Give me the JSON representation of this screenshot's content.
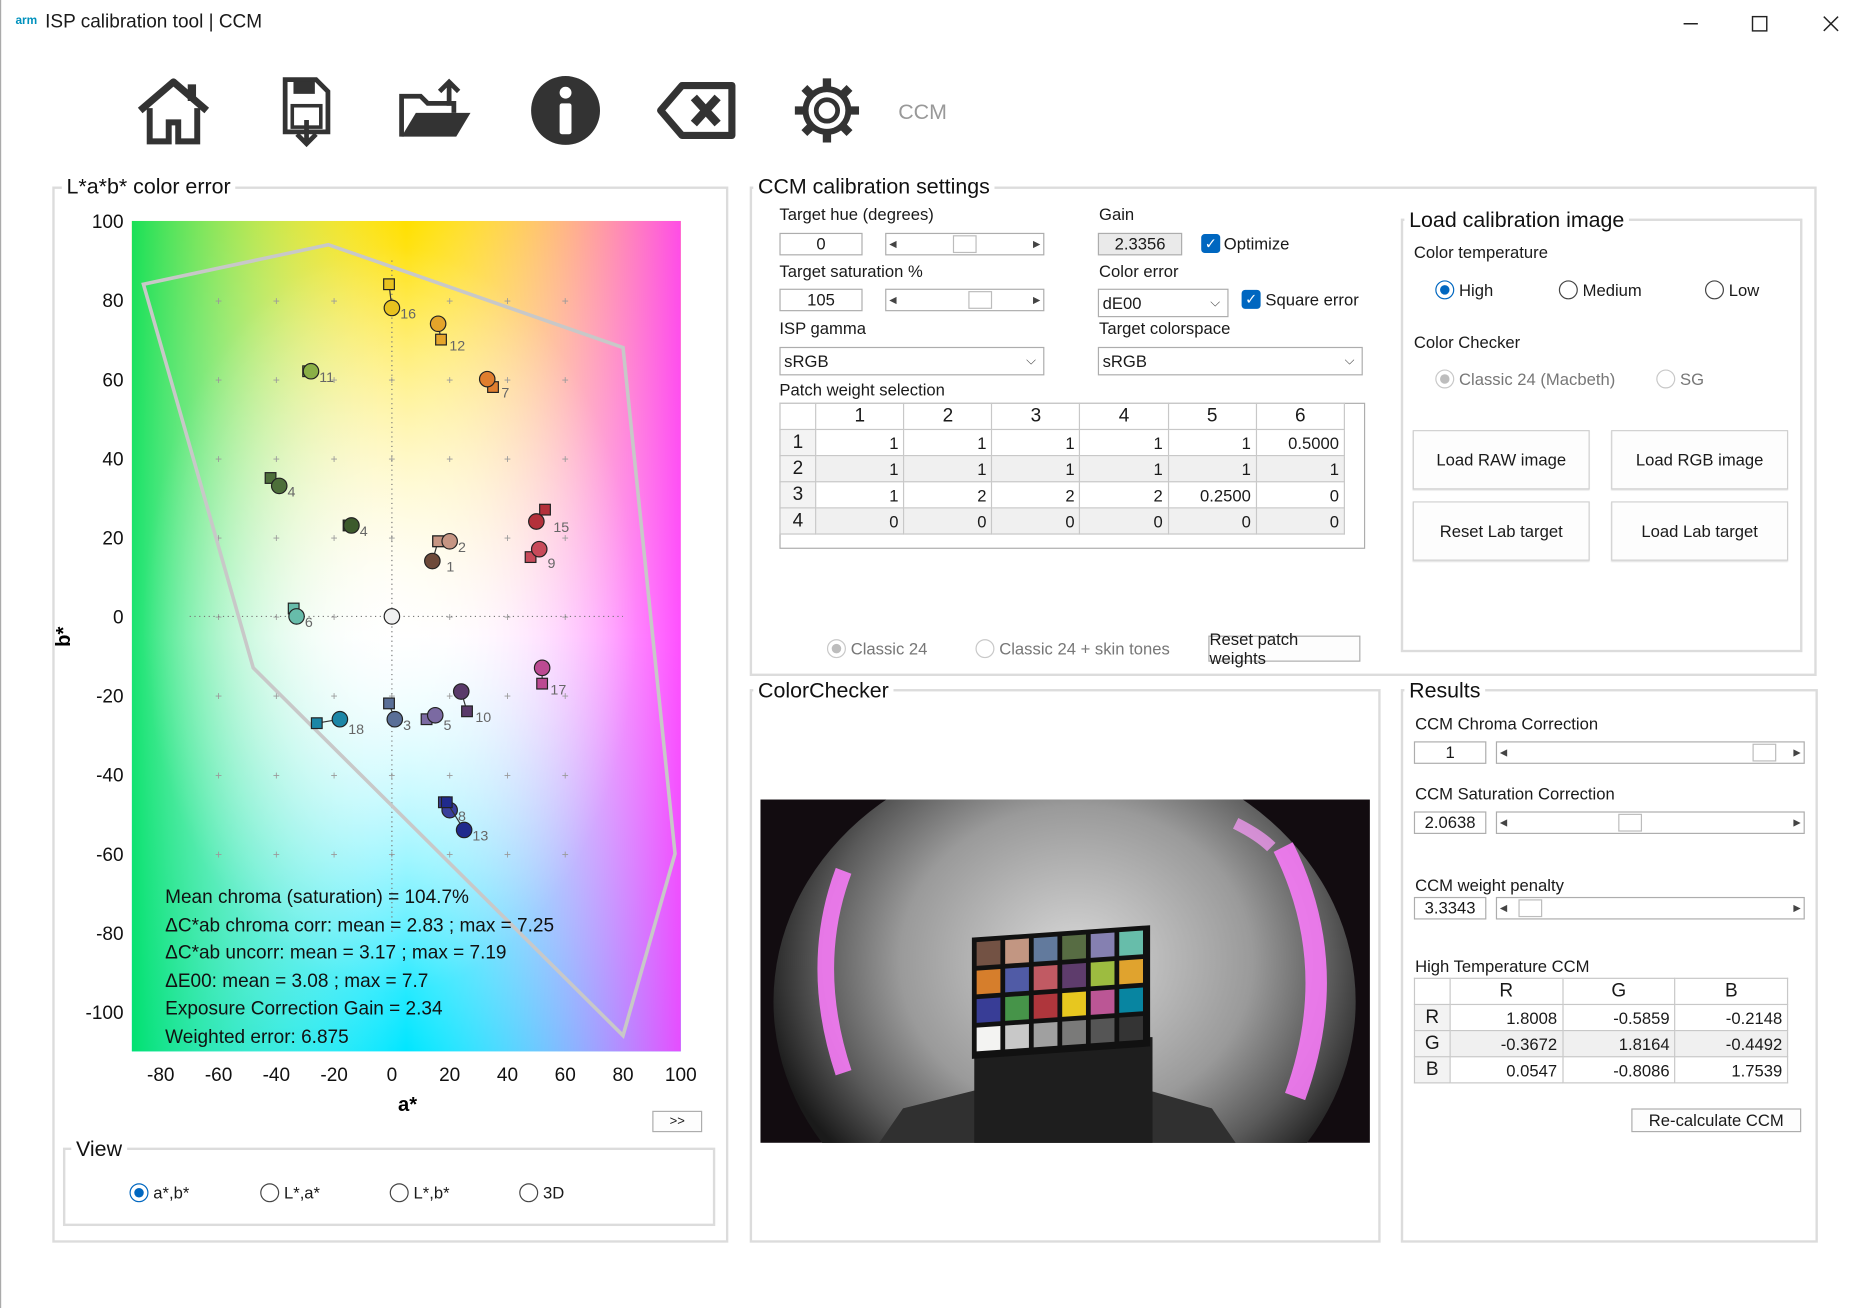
{
  "window": {
    "logo": "arm",
    "title": "ISP calibration tool | CCM"
  },
  "toolbar": {
    "items": [
      "home-icon",
      "save-icon",
      "open-folder-icon",
      "info-icon",
      "clear-icon",
      "settings-icon"
    ],
    "mode_label": "CCM"
  },
  "lab_panel": {
    "title": "L*a*b* color error",
    "xlabel": "a*",
    "ylabel": "b*",
    "stats": [
      "Mean chroma (saturation) = 104.7%",
      "ΔC*ab chroma corr: mean = 2.83 ; max = 7.25",
      "ΔC*ab uncorr: mean = 3.17 ; max = 7.19",
      "ΔE00: mean = 3.08 ; max = 7.7",
      "Exposure Correction Gain = 2.34",
      "Weighted error: 6.875"
    ],
    "expand_button": ">>"
  },
  "chart_data": {
    "type": "scatter",
    "title": "",
    "xlabel": "a*",
    "ylabel": "b*",
    "xlim": [
      -90,
      100
    ],
    "ylim": [
      -110,
      100
    ],
    "xticks": [
      -80,
      -60,
      -40,
      -20,
      0,
      20,
      40,
      60,
      80,
      100
    ],
    "yticks": [
      100,
      80,
      60,
      40,
      20,
      0,
      -20,
      -40,
      -60,
      -80,
      -100
    ],
    "gamut_outline": [
      [
        -86,
        84
      ],
      [
        -22,
        94
      ],
      [
        80,
        68
      ],
      [
        98,
        -60
      ],
      [
        80,
        -106
      ],
      [
        -48,
        -13
      ]
    ],
    "series": [
      {
        "markers": "circle (measured) + square (target)",
        "points": [
          {
            "id": "1",
            "a": 14,
            "b": 14,
            "ta": 16,
            "tb": 19,
            "color": "#6e4a3a"
          },
          {
            "id": "2",
            "a": 20,
            "b": 19,
            "ta": 16,
            "tb": 19,
            "color": "#c69583"
          },
          {
            "id": "3",
            "a": 1,
            "b": -26,
            "ta": -1,
            "tb": -22,
            "color": "#5a6f97"
          },
          {
            "id": "4",
            "a": -39,
            "b": 33,
            "ta": -42,
            "tb": 35,
            "color": "#4d6f3a"
          },
          {
            "id": "4",
            "a": -14,
            "b": 23,
            "ta": -15,
            "tb": 23,
            "color": "#3c5a2c"
          },
          {
            "id": "5",
            "a": 15,
            "b": -25,
            "ta": 12,
            "tb": -26,
            "color": "#7b6aa2"
          },
          {
            "id": "6",
            "a": -33,
            "b": 0,
            "ta": -34,
            "tb": 2,
            "color": "#67bcaa"
          },
          {
            "id": "7",
            "a": 33,
            "b": 60,
            "ta": 35,
            "tb": 58,
            "color": "#e07e2e"
          },
          {
            "id": "8",
            "a": 20,
            "b": -49,
            "ta": 18,
            "tb": -47,
            "color": "#3a3f9c"
          },
          {
            "id": "9",
            "a": 51,
            "b": 17,
            "ta": 48,
            "tb": 15,
            "color": "#c84a5a"
          },
          {
            "id": "10",
            "a": 24,
            "b": -19,
            "ta": 26,
            "tb": -24,
            "color": "#5a3a6a"
          },
          {
            "id": "11",
            "a": -28,
            "b": 62,
            "ta": -29,
            "tb": 62,
            "color": "#8ab046"
          },
          {
            "id": "12",
            "a": 16,
            "b": 74,
            "ta": 17,
            "tb": 70,
            "color": "#e4a42a"
          },
          {
            "id": "13",
            "a": 25,
            "b": -54,
            "ta": 19,
            "tb": -47,
            "color": "#202a8c"
          },
          {
            "id": "15",
            "a": 50,
            "b": 24,
            "ta": 53,
            "tb": 27,
            "color": "#b4303a"
          },
          {
            "id": "16",
            "a": 0,
            "b": 78,
            "ta": -1,
            "tb": 84,
            "color": "#e8c21e"
          },
          {
            "id": "17",
            "a": 52,
            "b": -13,
            "ta": 52,
            "tb": -17,
            "color": "#bc4a92"
          },
          {
            "id": "18",
            "a": -18,
            "b": -26,
            "ta": -26,
            "tb": -27,
            "color": "#1c86a6"
          },
          {
            "id": "",
            "a": 0,
            "b": 0,
            "ta": 0,
            "tb": 0,
            "color": "#f0f0f0"
          }
        ]
      }
    ],
    "grid": "dotted cross at origin",
    "legend": "none"
  },
  "view": {
    "title": "View",
    "options": [
      "a*,b*",
      "L*,a*",
      "L*,b*",
      "3D"
    ],
    "selected": "a*,b*"
  },
  "ccm_settings": {
    "title": "CCM calibration settings",
    "target_hue_label": "Target hue (degrees)",
    "target_hue": "0",
    "target_hue_level": 0.5,
    "target_sat_label": "Target saturation %",
    "target_sat": "105",
    "target_sat_level": 0.65,
    "gain_label": "Gain",
    "gain": "2.3356",
    "optimize_label": "Optimize",
    "optimize": true,
    "color_error_label": "Color error",
    "color_error": "dE00",
    "square_error_label": "Square error",
    "square_error": true,
    "isp_gamma_label": "ISP gamma",
    "isp_gamma": "sRGB",
    "target_colorspace_label": "Target colorspace",
    "target_colorspace": "sRGB",
    "patch_weight_label": "Patch weight selection",
    "weights": {
      "columns": [
        "1",
        "2",
        "3",
        "4",
        "5",
        "6"
      ],
      "rows": [
        {
          "h": "1",
          "cells": [
            "1",
            "1",
            "1",
            "1",
            "1",
            "0.5000"
          ]
        },
        {
          "h": "2",
          "cells": [
            "1",
            "1",
            "1",
            "1",
            "1",
            "1"
          ]
        },
        {
          "h": "3",
          "cells": [
            "1",
            "2",
            "2",
            "2",
            "0.2500",
            "0"
          ]
        },
        {
          "h": "4",
          "cells": [
            "0",
            "0",
            "0",
            "0",
            "0",
            "0"
          ]
        }
      ]
    },
    "classic24_label": "Classic 24",
    "classic24_skin_label": "Classic 24 + skin tones",
    "reset_weights_label": "Reset patch weights"
  },
  "load_image": {
    "title": "Load calibration image",
    "color_temp_label": "Color temperature",
    "temp_options": [
      "High",
      "Medium",
      "Low"
    ],
    "temp_selected": "High",
    "checker_label": "Color Checker",
    "checker_options": [
      "Classic 24 (Macbeth)",
      "SG"
    ],
    "buttons": [
      "Load RAW image",
      "Load RGB image",
      "Reset Lab target",
      "Load Lab target"
    ]
  },
  "colorchecker": {
    "title": "ColorChecker",
    "patches": [
      "#735244",
      "#c29682",
      "#627a9d",
      "#576c43",
      "#8580b1",
      "#67bdaa",
      "#d67e2c",
      "#505ba6",
      "#c15a63",
      "#5e3c6c",
      "#9dbc40",
      "#e0a32e",
      "#383d96",
      "#469449",
      "#af363c",
      "#e7c71f",
      "#bb5695",
      "#0885a1",
      "#f3f3f2",
      "#c8c8c8",
      "#a0a0a0",
      "#7a7a79",
      "#555555",
      "#343434"
    ]
  },
  "results": {
    "title": "Results",
    "chroma_label": "CCM Chroma Correction",
    "chroma": "1",
    "chroma_level": 0.95,
    "sat_label": "CCM Saturation Correction",
    "sat": "2.0638",
    "sat_level": 0.42,
    "penalty_label": "CCM weight penalty",
    "penalty": "3.3343",
    "penalty_level": 0.03,
    "matrix_label": "High Temperature CCM",
    "matrix": {
      "columns": [
        "R",
        "G",
        "B"
      ],
      "rows": [
        {
          "h": "R",
          "cells": [
            "1.8008",
            "-0.5859",
            "-0.2148"
          ]
        },
        {
          "h": "G",
          "cells": [
            "-0.3672",
            "1.8164",
            "-0.4492"
          ]
        },
        {
          "h": "B",
          "cells": [
            "0.0547",
            "-0.8086",
            "1.7539"
          ]
        }
      ]
    },
    "recalc_label": "Re-calculate CCM"
  }
}
